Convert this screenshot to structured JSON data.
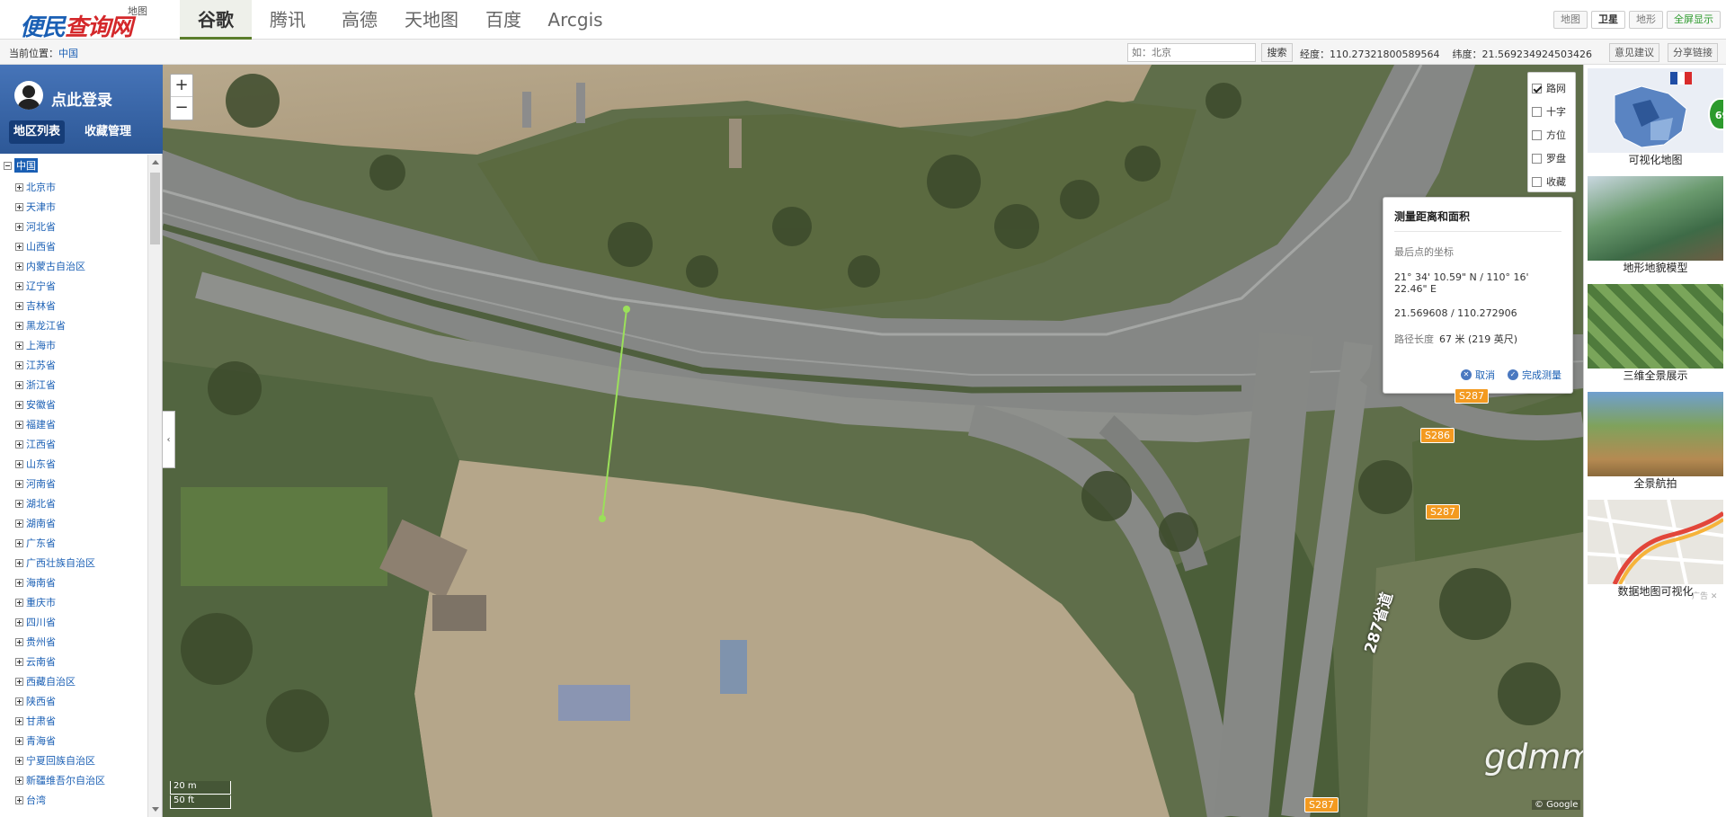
{
  "logo": {
    "main": "便民",
    "highlight": "查询网",
    "sub": "地图"
  },
  "tabs": [
    {
      "label": "谷歌",
      "active": true
    },
    {
      "label": "腾讯"
    },
    {
      "label": "高德"
    },
    {
      "label": "天地图"
    },
    {
      "label": "百度"
    },
    {
      "label": "Arcgis"
    }
  ],
  "header_buttons": [
    {
      "label": "地图"
    },
    {
      "label": "卫星",
      "active": true
    },
    {
      "label": "地形"
    },
    {
      "label": "全屏显示"
    }
  ],
  "infobar": {
    "location_label": "当前位置：",
    "location_value": "中国",
    "search_placeholder": "如：北京",
    "search_button": "搜索",
    "longitude": "经度：110.27321800589564",
    "latitude": "纬度：21.569234924503426",
    "feedback": "意见建议",
    "share": "分享链接"
  },
  "sidebar": {
    "login": "点此登录",
    "tab_regions": "地区列表",
    "tab_favorites": "收藏管理",
    "root": "中国",
    "provinces": [
      "北京市",
      "天津市",
      "河北省",
      "山西省",
      "内蒙古自治区",
      "辽宁省",
      "吉林省",
      "黑龙江省",
      "上海市",
      "江苏省",
      "浙江省",
      "安徽省",
      "福建省",
      "江西省",
      "山东省",
      "河南省",
      "湖北省",
      "湖南省",
      "广东省",
      "广西壮族自治区",
      "海南省",
      "重庆市",
      "四川省",
      "贵州省",
      "云南省",
      "西藏自治区",
      "陕西省",
      "甘肃省",
      "青海省",
      "宁夏回族自治区",
      "新疆维吾尔自治区",
      "台湾"
    ]
  },
  "map": {
    "zoom_in": "+",
    "zoom_out": "−",
    "collapse": "‹",
    "scale_m": "20 m",
    "scale_ft": "50 ft",
    "layers": [
      {
        "label": "路网",
        "checked": true
      },
      {
        "label": "十字",
        "checked": false
      },
      {
        "label": "方位",
        "checked": false
      },
      {
        "label": "罗盘",
        "checked": false
      },
      {
        "label": "收藏",
        "checked": false
      }
    ],
    "measure": {
      "title": "测量距离和面积",
      "last_point": "最后点的坐标",
      "dms": "21° 34' 10.59\" N / 110° 16' 22.46\" E",
      "decimal": "21.569608 / 110.272906",
      "length_label": "路径长度",
      "length_value": "67 米 (219 英尺)",
      "cancel": "取消",
      "finish": "完成测量"
    },
    "road_badges": [
      "S287",
      "S286",
      "S287",
      "S287"
    ],
    "road_label": "287省道",
    "watermark": "gdmm.com",
    "copyright": "© Google"
  },
  "right_panel": {
    "cards": [
      {
        "label": "可视化地图"
      },
      {
        "label": "地形地貌模型"
      },
      {
        "label": "三维全景展示"
      },
      {
        "label": "全景航拍"
      },
      {
        "label": "数据地图可视化"
      }
    ],
    "badge": "69",
    "ad": "广告 ✕"
  },
  "colors": {
    "brand_blue": "#1a5fb4",
    "brand_red": "#d4282b",
    "active_green": "#5a7d2a",
    "badge_orange": "#f39a20",
    "measure_line": "#9be05a"
  }
}
